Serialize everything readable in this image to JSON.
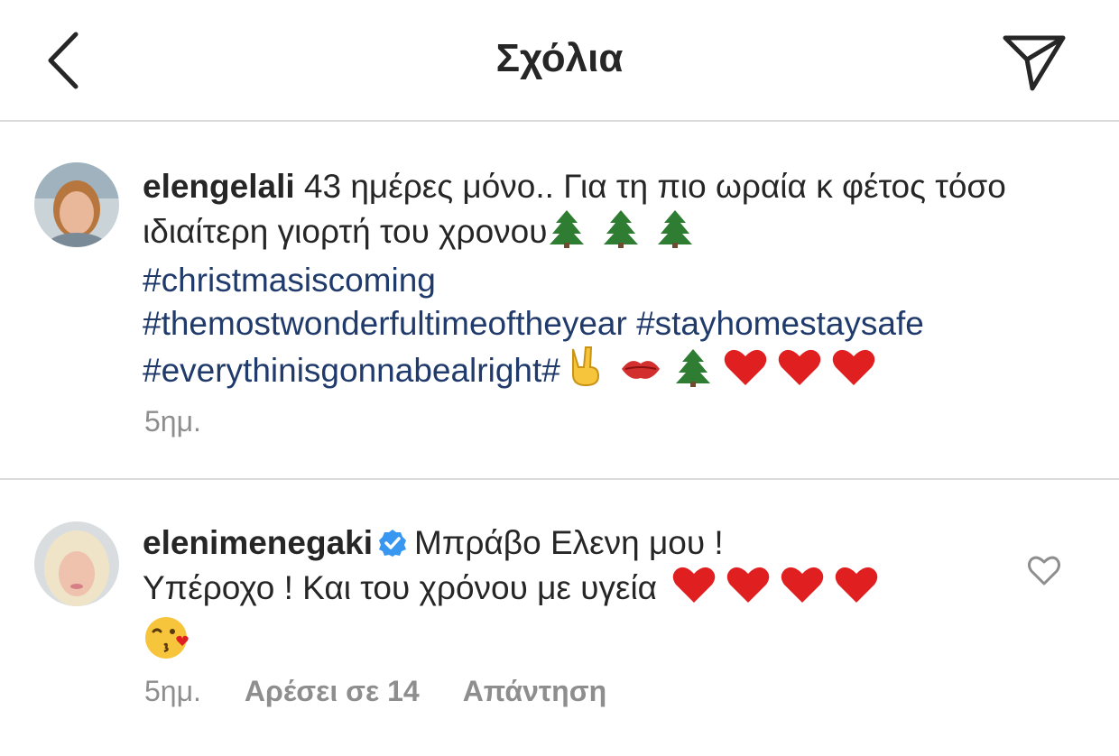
{
  "header": {
    "title": "Σχόλια"
  },
  "caption": {
    "username": "elengelali",
    "text_1": " 43 ημέρες μόνο.. Για τη πιο ωραία κ φέτος τόσο ιδιαίτερη γιορτή του χρονου",
    "hashtags": [
      "#christmasiscoming",
      "#themostwonderfultimeoftheyear",
      "#stayhomestaysafe",
      "#everythinisgonnabealright#"
    ],
    "time": "5ημ."
  },
  "comment": {
    "username": "elenimenegaki",
    "text_1": "Μπράβο Ελενη μου !",
    "text_2": "Υπέροχο ! Και του χρόνου με υγεία",
    "time": "5ημ.",
    "likes": "Αρέσει σε 14",
    "reply": "Απάντηση"
  },
  "icons": {
    "back": "chevron-left-icon",
    "share": "paper-plane-icon",
    "verified": "verified-badge-icon",
    "like": "heart-outline-icon"
  },
  "colors": {
    "hashtag": "#1f3a6b",
    "verified": "#3897f0",
    "muted": "#8e8e8e",
    "divider": "#dbdbdb"
  }
}
